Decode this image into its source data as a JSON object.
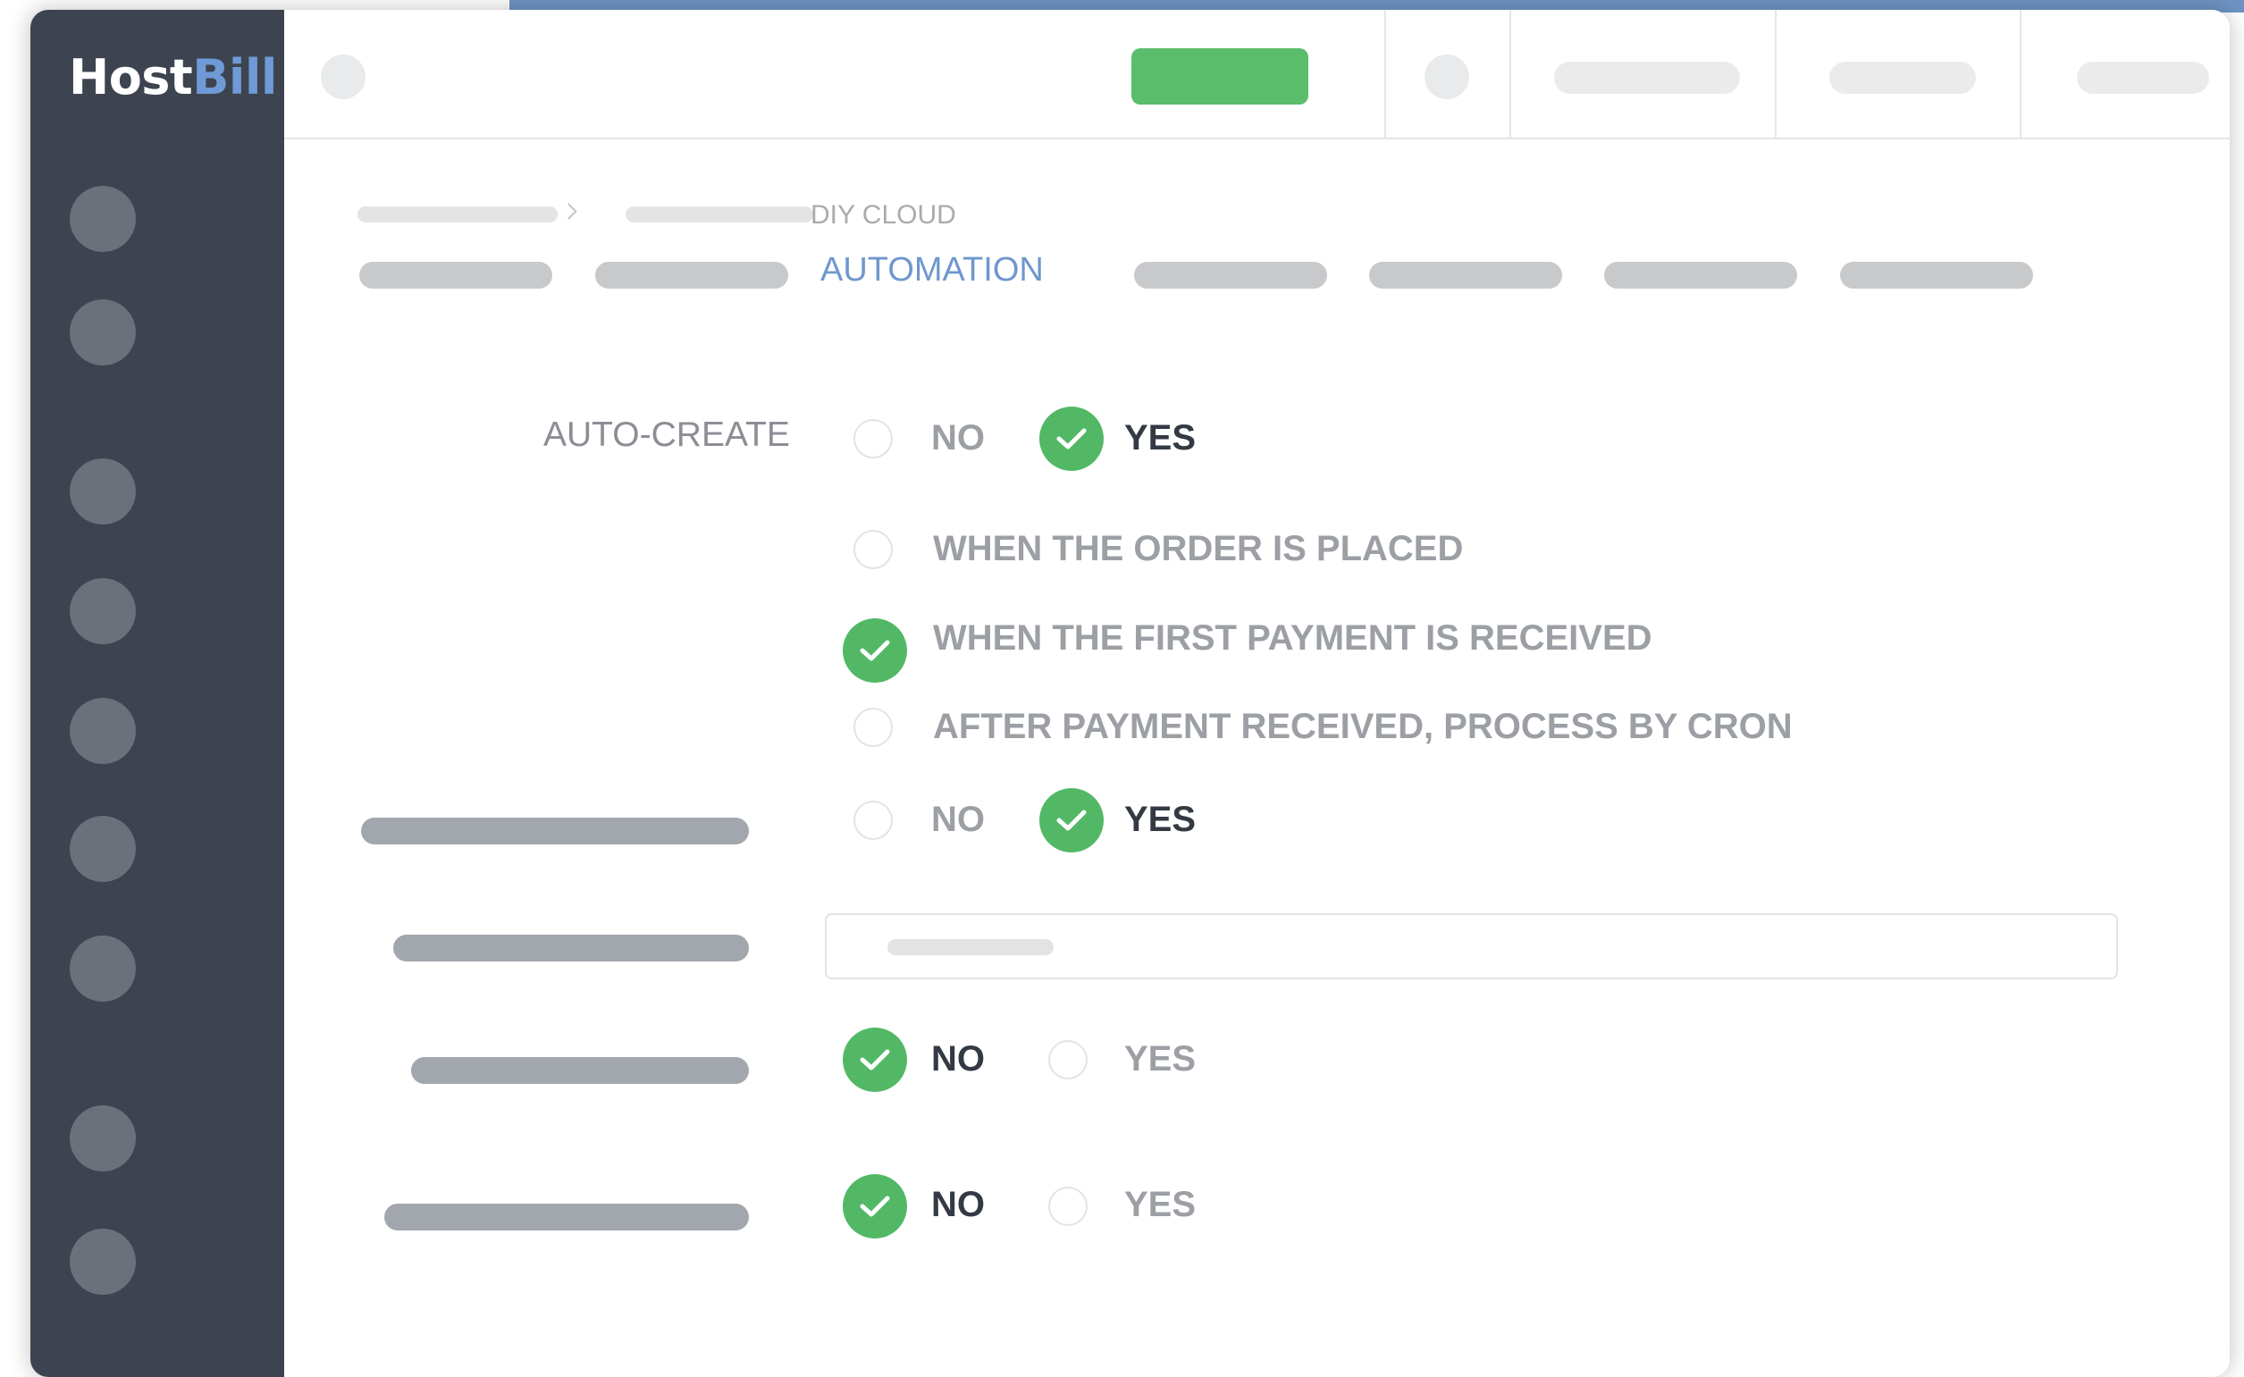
{
  "app": {
    "logo_host": "Host",
    "logo_bill": "Bill"
  },
  "breadcrumb": {
    "current": "DIY CLOUD"
  },
  "tabs": {
    "active_label": "AUTOMATION"
  },
  "form": {
    "auto_create": {
      "label": "AUTO-CREATE",
      "no_label": "NO",
      "yes_label": "YES",
      "selected": "YES",
      "timing_options": [
        {
          "label": "WHEN THE ORDER IS PLACED",
          "selected": false
        },
        {
          "label": "WHEN THE FIRST PAYMENT IS RECEIVED",
          "selected": true
        },
        {
          "label": "AFTER PAYMENT RECEIVED, PROCESS BY CRON",
          "selected": false
        }
      ]
    },
    "row2": {
      "no_label": "NO",
      "yes_label": "YES",
      "selected": "YES"
    },
    "row4": {
      "no_label": "NO",
      "yes_label": "YES",
      "selected": "NO"
    },
    "row5": {
      "no_label": "NO",
      "yes_label": "YES",
      "selected": "NO"
    }
  },
  "icons": {
    "check": "check-icon",
    "chevron": "chevron-right-icon"
  },
  "colors": {
    "sidebar": "#3d4450",
    "accent_blue": "#6f97cd",
    "check_green": "#52b866",
    "primary_button": "#5abd6b"
  }
}
